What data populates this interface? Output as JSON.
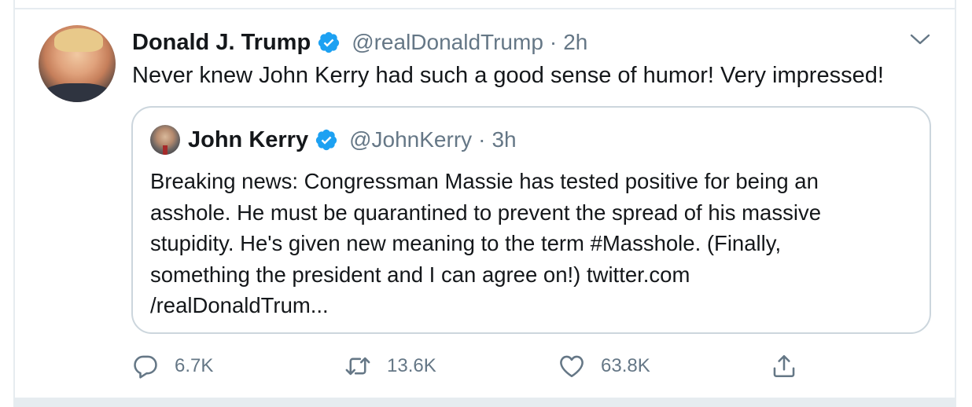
{
  "tweet": {
    "author_name": "Donald J. Trump",
    "author_handle": "@realDonaldTrump",
    "separator": "·",
    "time": "2h",
    "text": "Never knew John Kerry had such a good sense of humor! Very impressed!"
  },
  "quoted_tweet": {
    "author_name": "John Kerry",
    "author_handle": "@JohnKerry",
    "separator": "·",
    "time": "3h",
    "text_lines": [
      "Breaking news: Congressman Massie has tested positive for being an",
      "asshole. He must be quarantined to prevent the spread of his massive",
      "stupidity. He's given new meaning to the term #Masshole. (Finally,",
      "something the president and I can agree on!) twitter.com",
      "/realDonaldTrum..."
    ]
  },
  "actions": {
    "reply_count": "6.7K",
    "retweet_count": "13.6K",
    "like_count": "63.8K"
  },
  "icons": {
    "verified": "verified-badge-icon",
    "caret": "chevron-down-icon",
    "reply": "reply-icon",
    "retweet": "retweet-icon",
    "like": "heart-icon",
    "share": "share-icon"
  },
  "colors": {
    "verified_blue": "#1da1f2",
    "secondary_text": "#657786",
    "border": "#ccd6dd",
    "primary_text": "#14171a"
  }
}
